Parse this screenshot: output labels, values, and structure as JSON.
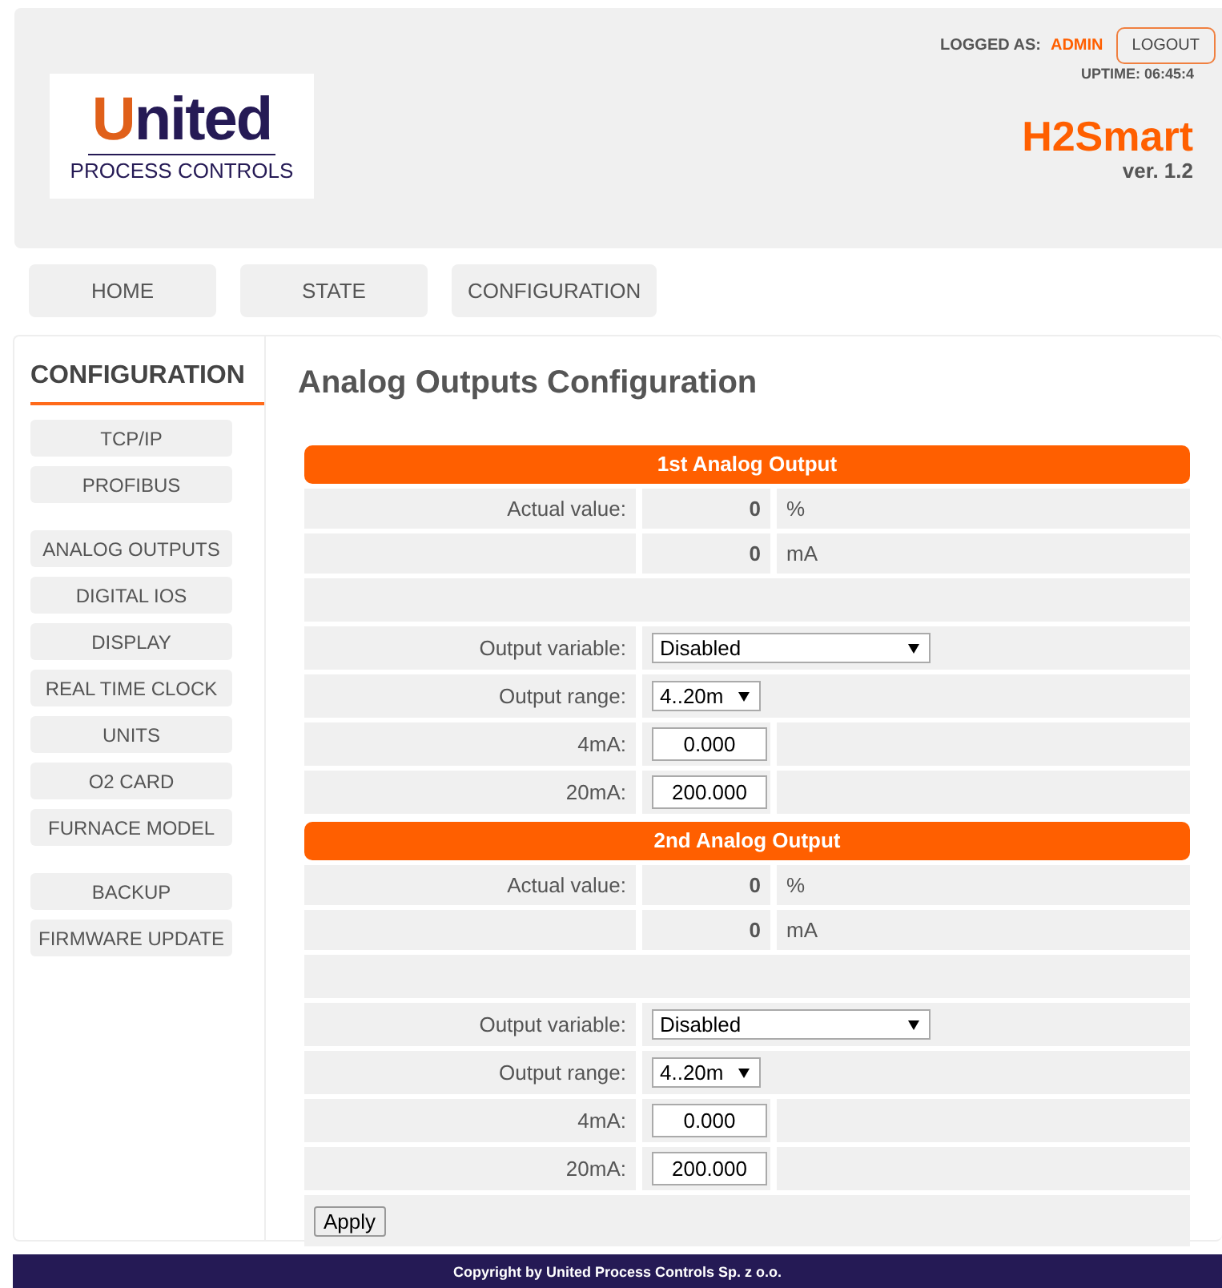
{
  "header": {
    "logo": {
      "name": "United",
      "subtitle": "PROCESS CONTROLS"
    },
    "logged_as_label": "LOGGED AS:",
    "user": "ADMIN",
    "logout": "LOGOUT",
    "uptime": "UPTIME: 06:45:4",
    "product": "H2Smart",
    "version": "ver. 1.2"
  },
  "nav": [
    "HOME",
    "STATE",
    "CONFIGURATION"
  ],
  "sidebar": {
    "title": "CONFIGURATION",
    "groups": [
      [
        "TCP/IP",
        "PROFIBUS"
      ],
      [
        "ANALOG OUTPUTS",
        "DIGITAL IOS",
        "DISPLAY",
        "REAL TIME CLOCK",
        "UNITS",
        "O2 CARD",
        "FURNACE MODEL"
      ],
      [
        "BACKUP",
        "FIRMWARE UPDATE"
      ]
    ]
  },
  "page_title": "Analog Outputs Configuration",
  "outputs": [
    {
      "title": "1st Analog Output",
      "actual_label": "Actual value:",
      "percent": "0",
      "percent_unit": "%",
      "current": "0",
      "current_unit": "mA",
      "variable_label": "Output variable:",
      "variable": "Disabled",
      "range_label": "Output range:",
      "range": "4..20m",
      "low_label": "4mA:",
      "low": "0.000",
      "high_label": "20mA:",
      "high": "200.000"
    },
    {
      "title": "2nd Analog Output",
      "actual_label": "Actual value:",
      "percent": "0",
      "percent_unit": "%",
      "current": "0",
      "current_unit": "mA",
      "variable_label": "Output variable:",
      "variable": "Disabled",
      "range_label": "Output range:",
      "range": "4..20m",
      "low_label": "4mA:",
      "low": "0.000",
      "high_label": "20mA:",
      "high": "200.000"
    }
  ],
  "apply": "Apply",
  "footer": "Copyright by United Process Controls Sp. z o.o."
}
